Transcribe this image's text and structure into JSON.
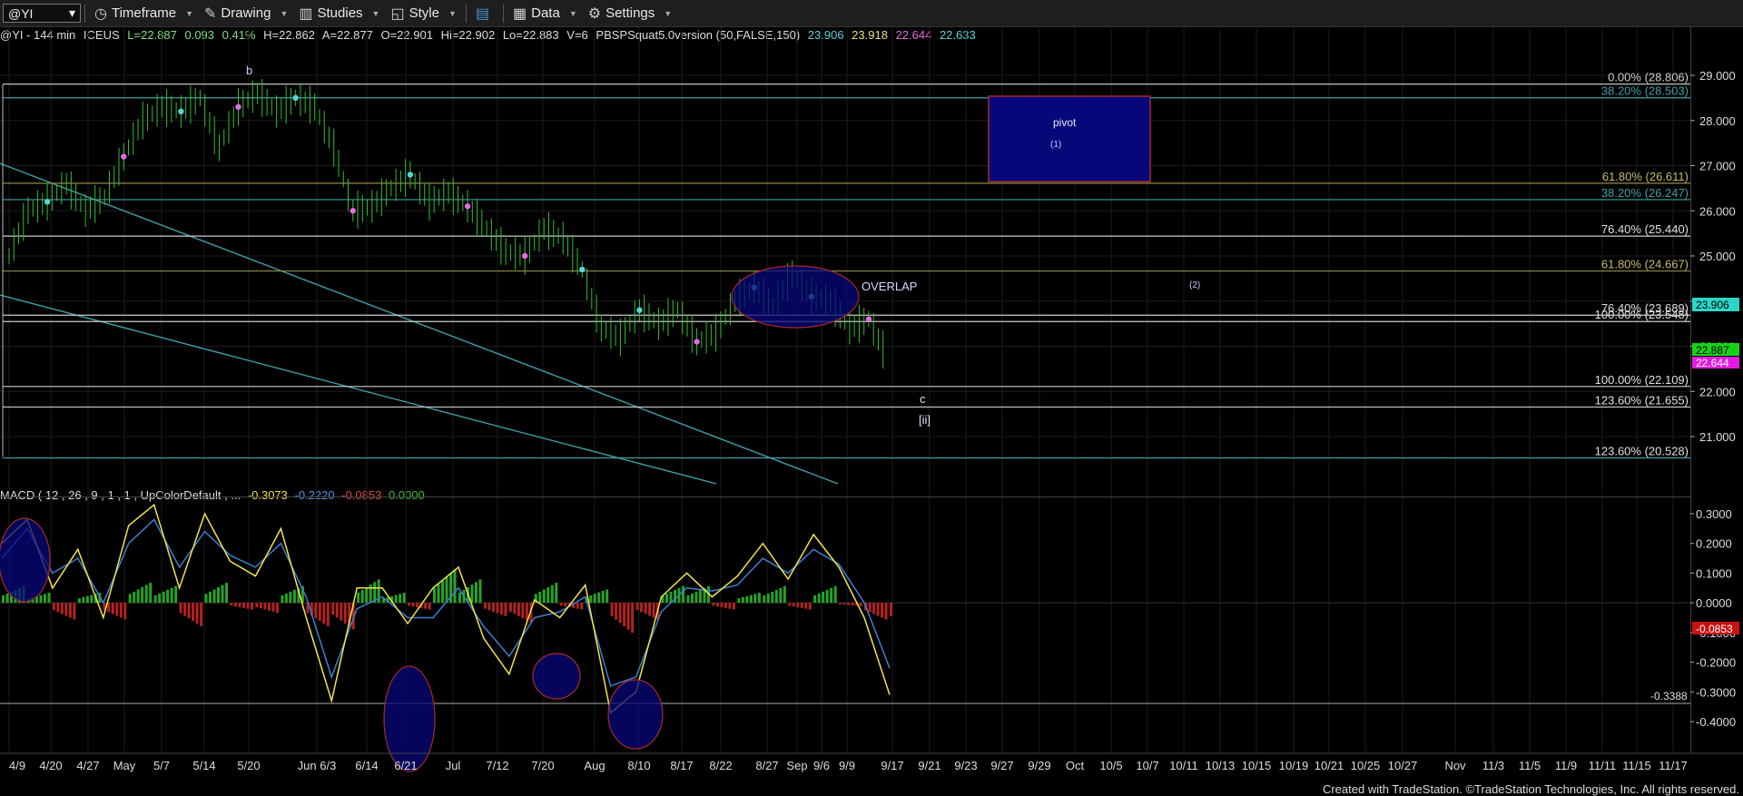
{
  "toolbar": {
    "symbol": "@YI",
    "timeframe": "Timeframe",
    "drawing": "Drawing",
    "studies": "Studies",
    "style": "Style",
    "data": "Data",
    "settings": "Settings"
  },
  "header": {
    "title": "@YI - 144 min",
    "exchange": "ICEUS",
    "last": "L=22.887",
    "chg": "0.093",
    "pct": "0.41%",
    "hi_open": "H=22.862",
    "ask": "A=22.877",
    "open": "O=22.901",
    "hi": "Hi=22.902",
    "lo": "Lo=22.883",
    "vol": "V=6",
    "study": "PBSPSquat5.0version (50,FALSE,150)",
    "v1": "23.906",
    "v2": "23.918",
    "v3": "22.644",
    "v4": "22.633"
  },
  "macd_header": {
    "label": "MACD ( 12 , 26 , 9 , 1 , 1 , UpColorDefault , ...",
    "macd": "-0.3073",
    "avg": "-0.2220",
    "diff": "-0.0853",
    "zero": "0.0000"
  },
  "colors": {
    "up_bar": "#2fbf2f",
    "macd_line": "#f2e34a",
    "signal_line": "#3d7fd0",
    "hist_pos": "#27a327",
    "hist_neg": "#b32222",
    "fib_white": "#cccccc",
    "fib_olive": "#8f8a45",
    "fib_teal": "#3f9fa8",
    "pivot_fill": "#07077a",
    "pivot_border": "#a52a2a"
  },
  "chart_data": [
    {
      "type": "line",
      "name": "price",
      "ylim": [
        20.0,
        29.5
      ],
      "y_ticks": [
        "29.000",
        "28.000",
        "27.000",
        "26.000",
        "25.000",
        "24.000",
        "23.000",
        "22.000",
        "21.000"
      ],
      "y_tick_values": [
        29,
        28,
        27,
        26,
        25,
        24,
        23,
        22,
        21
      ],
      "x_ticks": [
        "4/9",
        "4/20",
        "4/27",
        "May",
        "5/7",
        "5/14",
        "5/20",
        "Jun 6/3",
        "6/14",
        "6/21",
        "Jul",
        "7/12",
        "7/20",
        "Aug",
        "8/10",
        "8/17",
        "8/22",
        "8/27",
        "Sep",
        "9/6",
        "9/9",
        "9/17",
        "9/21",
        "9/23",
        "9/27",
        "9/29",
        "Oct",
        "10/5",
        "10/7",
        "10/11",
        "10/13",
        "10/15",
        "10/19",
        "10/21",
        "10/25",
        "10/27",
        "Nov",
        "11/3",
        "11/5",
        "11/9",
        "11/11",
        "11/15",
        "11/17"
      ],
      "x_index": [
        0,
        1,
        2,
        3,
        4,
        5,
        6,
        7,
        8,
        9,
        10,
        11,
        12,
        13,
        14,
        15,
        16,
        17,
        18,
        19,
        20,
        21,
        22,
        23,
        24,
        25,
        26,
        27,
        28,
        29,
        30,
        31,
        32,
        33,
        34,
        35,
        36,
        37,
        38,
        39,
        40,
        41,
        42
      ],
      "series": [
        {
          "values": [
            25.0,
            26.0,
            26.2,
            26.6,
            26.0,
            26.3,
            27.2,
            28.0,
            28.3,
            28.2,
            28.5,
            27.4,
            28.3,
            28.6,
            28.2,
            28.5,
            28.3,
            27.4,
            26.0,
            26.1,
            26.5,
            26.8,
            26.2,
            26.4,
            26.1,
            25.6,
            25.1,
            25.0,
            25.6,
            25.4,
            24.7,
            23.4,
            23.2,
            23.8,
            23.5,
            23.8,
            23.1,
            23.3,
            24.0,
            24.3,
            23.9,
            24.6,
            24.1,
            24.0,
            23.4,
            23.6,
            22.7
          ]
        }
      ],
      "current_price": "23.906",
      "last_price": "22.887",
      "low_price": "22.644"
    },
    {
      "type": "bar",
      "name": "MACD histogram",
      "ylim": [
        -0.47,
        0.37
      ],
      "y_ticks": [
        "0.3000",
        "0.2000",
        "0.1000",
        "0.0000",
        "-0.1000",
        "-0.2000",
        "-0.3000",
        "-0.4000"
      ],
      "y_tick_values": [
        0.3,
        0.2,
        0.1,
        0,
        -0.1,
        -0.2,
        -0.3,
        -0.4
      ],
      "macd_line": [
        0.2,
        0.28,
        0.05,
        0.18,
        -0.05,
        0.26,
        0.33,
        0.05,
        0.3,
        0.14,
        0.09,
        0.25,
        -0.05,
        -0.33,
        0.05,
        0.05,
        -0.07,
        0.05,
        0.12,
        -0.12,
        -0.24,
        0.01,
        -0.05,
        0.06,
        -0.37,
        -0.3,
        0.02,
        0.1,
        0.02,
        0.09,
        0.2,
        0.08,
        0.23,
        0.12,
        -0.05,
        -0.31
      ],
      "signal_line": [
        0.15,
        0.25,
        0.1,
        0.15,
        0.0,
        0.2,
        0.28,
        0.12,
        0.24,
        0.16,
        0.12,
        0.2,
        0.02,
        -0.25,
        -0.02,
        0.02,
        -0.05,
        -0.05,
        0.05,
        -0.08,
        -0.18,
        -0.05,
        -0.03,
        0.02,
        -0.28,
        -0.25,
        -0.03,
        0.05,
        0.04,
        0.06,
        0.15,
        0.1,
        0.18,
        0.13,
        0.0,
        -0.22
      ],
      "histogram": [
        0.05,
        0.03,
        -0.05,
        0.03,
        -0.05,
        0.06,
        0.05,
        -0.07,
        0.06,
        -0.02,
        -0.03,
        0.05,
        -0.07,
        -0.08,
        0.07,
        0.03,
        -0.02,
        0.1,
        0.07,
        -0.04,
        -0.06,
        0.06,
        -0.02,
        0.04,
        -0.09,
        -0.05,
        0.05,
        0.05,
        -0.02,
        0.03,
        0.05,
        -0.02,
        0.05,
        -0.01,
        -0.05,
        -0.09
      ],
      "current_label": "-0.0853",
      "level_label": "-0.3388"
    }
  ],
  "annotations": {
    "fibs": [
      {
        "label": "0.00% (28.806)",
        "price": 28.806
      },
      {
        "label": "38.20% (28.503)",
        "price": 28.503
      },
      {
        "label": "61.80% (26.611)",
        "price": 26.611
      },
      {
        "label": "38.20% (26.247)",
        "price": 26.247
      },
      {
        "label": "76.40% (25.440)",
        "price": 25.44
      },
      {
        "label": "61.80% (24.667)",
        "price": 24.667
      },
      {
        "label": "76.40% (23.689)",
        "price": 23.689
      },
      {
        "label": "100.00% (23.548)",
        "price": 23.548
      },
      {
        "label": "100.00% (22.109)",
        "price": 22.109
      },
      {
        "label": "123.60% (21.655)",
        "price": 21.655
      },
      {
        "label": "123.60% (20.528)",
        "price": 20.528
      }
    ],
    "pivot": "pivot",
    "pivot_sub": "(1)",
    "overlap": "OVERLAP",
    "wave2": "(2)",
    "wave_b": "b",
    "wave_c": "c",
    "wave_ii": "[ii]"
  },
  "credit": "Created with TradeStation. ©TradeStation Technologies, Inc. All rights reserved."
}
